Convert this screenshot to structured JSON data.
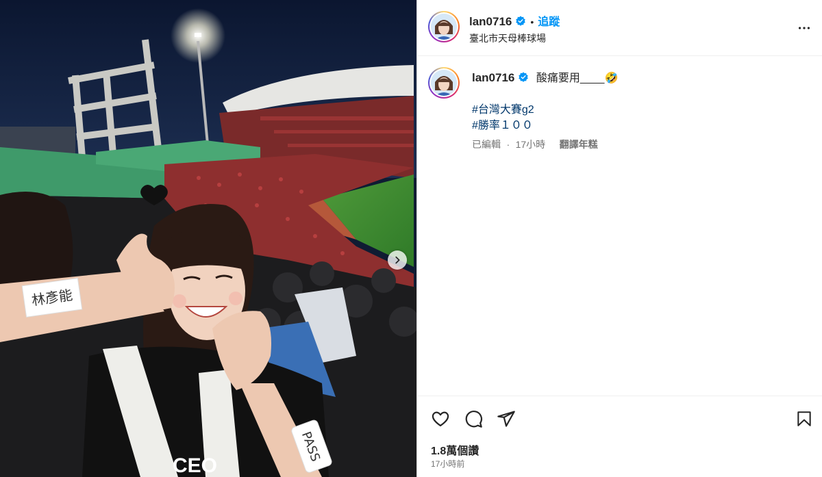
{
  "post": {
    "username": "lan0716",
    "follow_label": "追蹤",
    "dot": "•",
    "location": "臺北市天母棒球場"
  },
  "caption": {
    "username": "lan0716",
    "text": "酸痛要用____🤣",
    "hashtags": [
      "#台灣大賽g2",
      "#勝率１００"
    ],
    "edited": "已編輯",
    "separator": "·",
    "age": "17小時",
    "translate_label": "翻譯年糕"
  },
  "engagement": {
    "likes": "1.8萬個讚",
    "timestamp": "17小時前"
  },
  "photo": {
    "arm_label": "林彥能",
    "pass_label": "PASS"
  },
  "icons": {
    "verified": "verified-badge-icon",
    "more": "more-options-icon",
    "like": "heart-icon",
    "comment": "comment-icon",
    "share": "share-icon",
    "save": "bookmark-icon",
    "next": "chevron-right-icon"
  },
  "colors": {
    "follow_blue": "#0095f6",
    "hashtag_blue": "#00376b",
    "verified_blue": "#0095f6",
    "muted": "#737373"
  }
}
